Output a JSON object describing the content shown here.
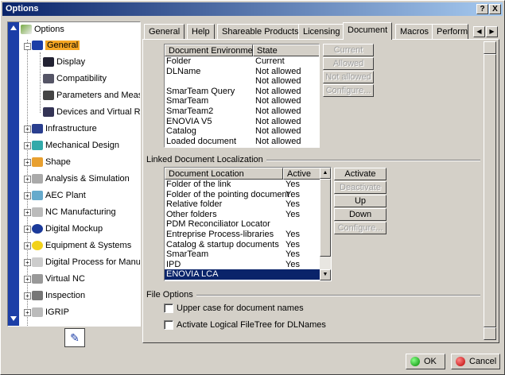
{
  "window": {
    "title": "Options",
    "help_btn": "?",
    "close_btn": "X"
  },
  "tree": {
    "items": [
      {
        "label": "Options"
      },
      {
        "label": "General"
      },
      {
        "label": "Display"
      },
      {
        "label": "Compatibility"
      },
      {
        "label": "Parameters and Measure"
      },
      {
        "label": "Devices and Virtual Reali"
      },
      {
        "label": "Infrastructure"
      },
      {
        "label": "Mechanical Design"
      },
      {
        "label": "Shape"
      },
      {
        "label": "Analysis & Simulation"
      },
      {
        "label": "AEC Plant"
      },
      {
        "label": "NC Manufacturing"
      },
      {
        "label": "Digital Mockup"
      },
      {
        "label": "Equipment & Systems"
      },
      {
        "label": "Digital Process for Manufac"
      },
      {
        "label": "Virtual NC"
      },
      {
        "label": "Inspection"
      },
      {
        "label": "IGRIP"
      }
    ]
  },
  "tabs": [
    "General",
    "Help",
    "Shareable Products",
    "Licensing",
    "Document",
    "Macros",
    "Performa"
  ],
  "tab_scroll": {
    "left": "◀",
    "right": "▶"
  },
  "doc_env": {
    "columns": [
      "Document Environment",
      "State"
    ],
    "rows": [
      [
        "Folder",
        "Current"
      ],
      [
        "DLName",
        "Not allowed"
      ],
      [
        "",
        "Not allowed"
      ],
      [
        "SmarTeam Query",
        "Not allowed"
      ],
      [
        "SmarTeam",
        "Not allowed"
      ],
      [
        "SmarTeam2",
        "Not allowed"
      ],
      [
        "ENOVIA V5",
        "Not allowed"
      ],
      [
        "Catalog",
        "Not allowed"
      ],
      [
        "Loaded document",
        "Not allowed"
      ]
    ],
    "buttons": [
      "Current",
      "Allowed",
      "Not allowed",
      "Configure..."
    ]
  },
  "linked": {
    "group_label": "Linked Document Localization",
    "columns": [
      "Document Location",
      "Active"
    ],
    "rows": [
      [
        "Folder of the link",
        "Yes"
      ],
      [
        "Folder of the pointing document",
        "Yes"
      ],
      [
        "Relative folder",
        "Yes"
      ],
      [
        "Other folders",
        "Yes"
      ],
      [
        "PDM Reconciliator Locator",
        ""
      ],
      [
        "Entreprise Process-libraries",
        "Yes"
      ],
      [
        "Catalog & startup documents",
        "Yes"
      ],
      [
        "SmarTeam",
        "Yes"
      ],
      [
        "IPD",
        "Yes"
      ],
      [
        "ENOVIA LCA",
        ""
      ]
    ],
    "buttons": [
      "Activate",
      "Deactivate",
      "Up",
      "Down",
      "Configure..."
    ]
  },
  "file_options": {
    "group_label": "File Options",
    "upper_case_label": "Upper case for document names",
    "logical_tree_label": "Activate Logical FileTree for DLNames"
  },
  "footer": {
    "ok": "OK",
    "cancel": "Cancel"
  },
  "colors": {
    "title_start": "#0a246a",
    "selection": "#0a246a",
    "highlight": "#f5a623"
  }
}
